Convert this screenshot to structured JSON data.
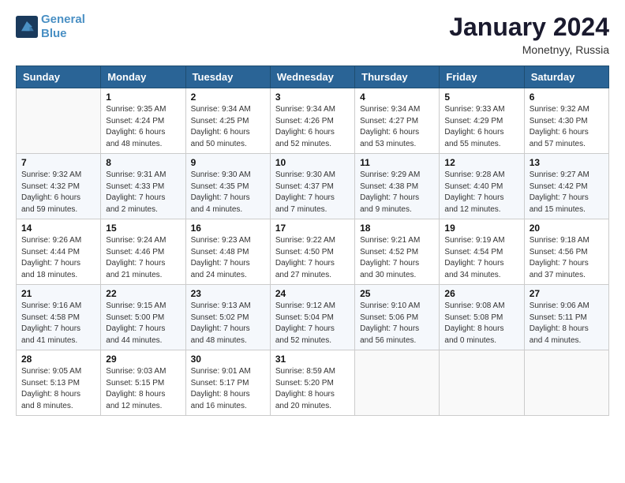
{
  "header": {
    "logo_line1": "General",
    "logo_line2": "Blue",
    "title": "January 2024",
    "subtitle": "Monetnyy, Russia"
  },
  "weekdays": [
    "Sunday",
    "Monday",
    "Tuesday",
    "Wednesday",
    "Thursday",
    "Friday",
    "Saturday"
  ],
  "weeks": [
    [
      {
        "day": "",
        "sunrise": "",
        "sunset": "",
        "daylight": ""
      },
      {
        "day": "1",
        "sunrise": "Sunrise: 9:35 AM",
        "sunset": "Sunset: 4:24 PM",
        "daylight": "Daylight: 6 hours and 48 minutes."
      },
      {
        "day": "2",
        "sunrise": "Sunrise: 9:34 AM",
        "sunset": "Sunset: 4:25 PM",
        "daylight": "Daylight: 6 hours and 50 minutes."
      },
      {
        "day": "3",
        "sunrise": "Sunrise: 9:34 AM",
        "sunset": "Sunset: 4:26 PM",
        "daylight": "Daylight: 6 hours and 52 minutes."
      },
      {
        "day": "4",
        "sunrise": "Sunrise: 9:34 AM",
        "sunset": "Sunset: 4:27 PM",
        "daylight": "Daylight: 6 hours and 53 minutes."
      },
      {
        "day": "5",
        "sunrise": "Sunrise: 9:33 AM",
        "sunset": "Sunset: 4:29 PM",
        "daylight": "Daylight: 6 hours and 55 minutes."
      },
      {
        "day": "6",
        "sunrise": "Sunrise: 9:32 AM",
        "sunset": "Sunset: 4:30 PM",
        "daylight": "Daylight: 6 hours and 57 minutes."
      }
    ],
    [
      {
        "day": "7",
        "sunrise": "Sunrise: 9:32 AM",
        "sunset": "Sunset: 4:32 PM",
        "daylight": "Daylight: 6 hours and 59 minutes."
      },
      {
        "day": "8",
        "sunrise": "Sunrise: 9:31 AM",
        "sunset": "Sunset: 4:33 PM",
        "daylight": "Daylight: 7 hours and 2 minutes."
      },
      {
        "day": "9",
        "sunrise": "Sunrise: 9:30 AM",
        "sunset": "Sunset: 4:35 PM",
        "daylight": "Daylight: 7 hours and 4 minutes."
      },
      {
        "day": "10",
        "sunrise": "Sunrise: 9:30 AM",
        "sunset": "Sunset: 4:37 PM",
        "daylight": "Daylight: 7 hours and 7 minutes."
      },
      {
        "day": "11",
        "sunrise": "Sunrise: 9:29 AM",
        "sunset": "Sunset: 4:38 PM",
        "daylight": "Daylight: 7 hours and 9 minutes."
      },
      {
        "day": "12",
        "sunrise": "Sunrise: 9:28 AM",
        "sunset": "Sunset: 4:40 PM",
        "daylight": "Daylight: 7 hours and 12 minutes."
      },
      {
        "day": "13",
        "sunrise": "Sunrise: 9:27 AM",
        "sunset": "Sunset: 4:42 PM",
        "daylight": "Daylight: 7 hours and 15 minutes."
      }
    ],
    [
      {
        "day": "14",
        "sunrise": "Sunrise: 9:26 AM",
        "sunset": "Sunset: 4:44 PM",
        "daylight": "Daylight: 7 hours and 18 minutes."
      },
      {
        "day": "15",
        "sunrise": "Sunrise: 9:24 AM",
        "sunset": "Sunset: 4:46 PM",
        "daylight": "Daylight: 7 hours and 21 minutes."
      },
      {
        "day": "16",
        "sunrise": "Sunrise: 9:23 AM",
        "sunset": "Sunset: 4:48 PM",
        "daylight": "Daylight: 7 hours and 24 minutes."
      },
      {
        "day": "17",
        "sunrise": "Sunrise: 9:22 AM",
        "sunset": "Sunset: 4:50 PM",
        "daylight": "Daylight: 7 hours and 27 minutes."
      },
      {
        "day": "18",
        "sunrise": "Sunrise: 9:21 AM",
        "sunset": "Sunset: 4:52 PM",
        "daylight": "Daylight: 7 hours and 30 minutes."
      },
      {
        "day": "19",
        "sunrise": "Sunrise: 9:19 AM",
        "sunset": "Sunset: 4:54 PM",
        "daylight": "Daylight: 7 hours and 34 minutes."
      },
      {
        "day": "20",
        "sunrise": "Sunrise: 9:18 AM",
        "sunset": "Sunset: 4:56 PM",
        "daylight": "Daylight: 7 hours and 37 minutes."
      }
    ],
    [
      {
        "day": "21",
        "sunrise": "Sunrise: 9:16 AM",
        "sunset": "Sunset: 4:58 PM",
        "daylight": "Daylight: 7 hours and 41 minutes."
      },
      {
        "day": "22",
        "sunrise": "Sunrise: 9:15 AM",
        "sunset": "Sunset: 5:00 PM",
        "daylight": "Daylight: 7 hours and 44 minutes."
      },
      {
        "day": "23",
        "sunrise": "Sunrise: 9:13 AM",
        "sunset": "Sunset: 5:02 PM",
        "daylight": "Daylight: 7 hours and 48 minutes."
      },
      {
        "day": "24",
        "sunrise": "Sunrise: 9:12 AM",
        "sunset": "Sunset: 5:04 PM",
        "daylight": "Daylight: 7 hours and 52 minutes."
      },
      {
        "day": "25",
        "sunrise": "Sunrise: 9:10 AM",
        "sunset": "Sunset: 5:06 PM",
        "daylight": "Daylight: 7 hours and 56 minutes."
      },
      {
        "day": "26",
        "sunrise": "Sunrise: 9:08 AM",
        "sunset": "Sunset: 5:08 PM",
        "daylight": "Daylight: 8 hours and 0 minutes."
      },
      {
        "day": "27",
        "sunrise": "Sunrise: 9:06 AM",
        "sunset": "Sunset: 5:11 PM",
        "daylight": "Daylight: 8 hours and 4 minutes."
      }
    ],
    [
      {
        "day": "28",
        "sunrise": "Sunrise: 9:05 AM",
        "sunset": "Sunset: 5:13 PM",
        "daylight": "Daylight: 8 hours and 8 minutes."
      },
      {
        "day": "29",
        "sunrise": "Sunrise: 9:03 AM",
        "sunset": "Sunset: 5:15 PM",
        "daylight": "Daylight: 8 hours and 12 minutes."
      },
      {
        "day": "30",
        "sunrise": "Sunrise: 9:01 AM",
        "sunset": "Sunset: 5:17 PM",
        "daylight": "Daylight: 8 hours and 16 minutes."
      },
      {
        "day": "31",
        "sunrise": "Sunrise: 8:59 AM",
        "sunset": "Sunset: 5:20 PM",
        "daylight": "Daylight: 8 hours and 20 minutes."
      },
      {
        "day": "",
        "sunrise": "",
        "sunset": "",
        "daylight": ""
      },
      {
        "day": "",
        "sunrise": "",
        "sunset": "",
        "daylight": ""
      },
      {
        "day": "",
        "sunrise": "",
        "sunset": "",
        "daylight": ""
      }
    ]
  ]
}
